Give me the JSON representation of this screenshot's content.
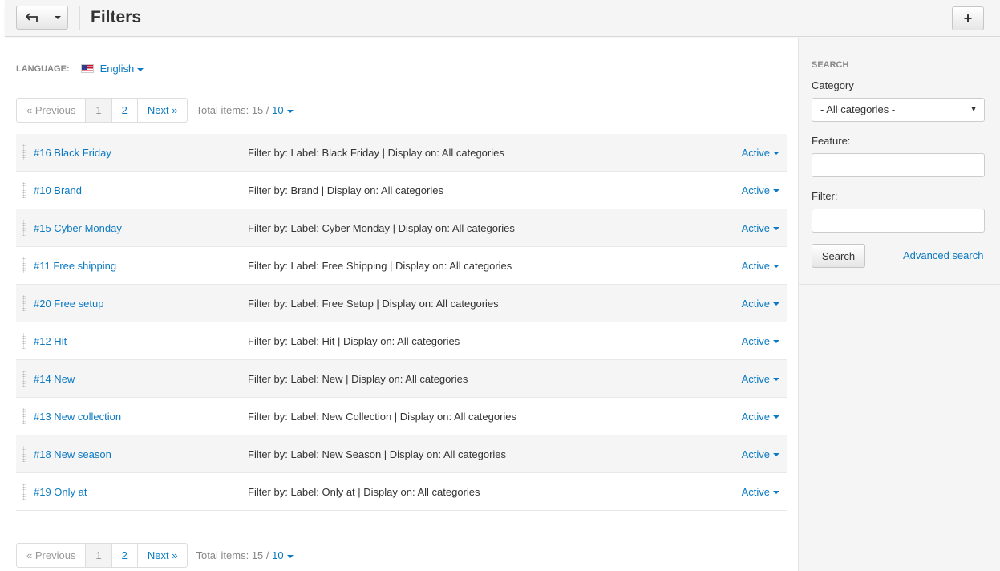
{
  "header": {
    "title": "Filters",
    "add_label": "+"
  },
  "language": {
    "label": "LANGUAGE:",
    "value": "English",
    "flag": "us-flag-icon"
  },
  "pagination": {
    "prev": "« Previous",
    "pages": [
      "1",
      "2"
    ],
    "next": "Next »",
    "total_label": "Total items: 15 /",
    "per_page": "10"
  },
  "rows": [
    {
      "name": "#16 Black Friday",
      "desc": "Filter by: Label: Black Friday | Display on: All categories",
      "status": "Active"
    },
    {
      "name": "#10 Brand",
      "desc": "Filter by: Brand | Display on: All categories",
      "status": "Active"
    },
    {
      "name": "#15 Cyber Monday",
      "desc": "Filter by: Label: Cyber Monday | Display on: All categories",
      "status": "Active"
    },
    {
      "name": "#11 Free shipping",
      "desc": "Filter by: Label: Free Shipping | Display on: All categories",
      "status": "Active"
    },
    {
      "name": "#20 Free setup",
      "desc": "Filter by: Label: Free Setup | Display on: All categories",
      "status": "Active"
    },
    {
      "name": "#12 Hit",
      "desc": "Filter by: Label: Hit | Display on: All categories",
      "status": "Active"
    },
    {
      "name": "#14 New",
      "desc": "Filter by: Label: New | Display on: All categories",
      "status": "Active"
    },
    {
      "name": "#13 New collection",
      "desc": "Filter by: Label: New Collection | Display on: All categories",
      "status": "Active"
    },
    {
      "name": "#18 New season",
      "desc": "Filter by: Label: New Season | Display on: All categories",
      "status": "Active"
    },
    {
      "name": "#19 Only at",
      "desc": "Filter by: Label: Only at | Display on: All categories",
      "status": "Active"
    }
  ],
  "sidebar": {
    "heading": "SEARCH",
    "category_label": "Category",
    "category_value": "- All categories -",
    "feature_label": "Feature:",
    "feature_value": "",
    "filter_label": "Filter:",
    "filter_value": "",
    "search_button": "Search",
    "advanced_link": "Advanced search"
  },
  "colors": {
    "link": "#0b7ac3",
    "row_alt": "#f5f5f5",
    "sidebar_bg": "#f5f5f5"
  }
}
